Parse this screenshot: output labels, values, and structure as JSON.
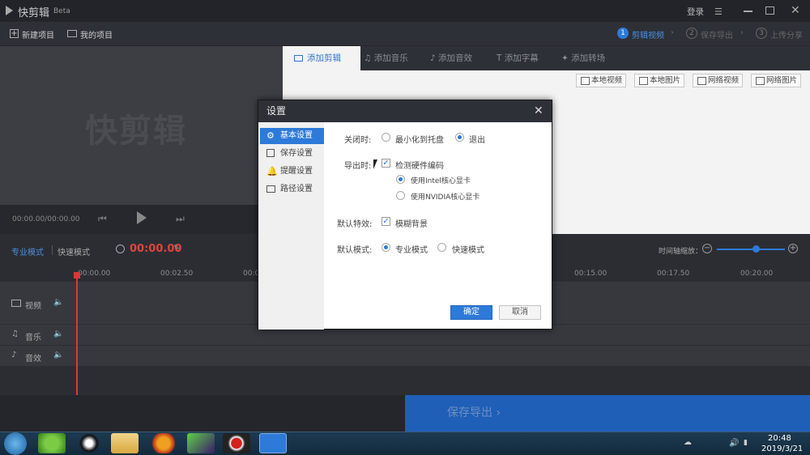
{
  "app": {
    "logo_text": "快剪辑",
    "badge": "Beta",
    "login": "登录",
    "watermark": "快剪辑"
  },
  "toolbar": {
    "new_project": "新建项目",
    "my_projects": "我的项目",
    "steps": [
      {
        "num": "1",
        "label": "剪辑视频"
      },
      {
        "num": "2",
        "label": "保存导出"
      },
      {
        "num": "3",
        "label": "上传分享"
      }
    ]
  },
  "tabs": [
    "添加剪辑",
    "添加音乐",
    "添加音效",
    "添加字幕",
    "添加转场"
  ],
  "sources": [
    "本地视频",
    "本地图片",
    "网络视频",
    "网络图片"
  ],
  "player": {
    "time": "00:00.00/00:00.00"
  },
  "timeline": {
    "mode_pro": "专业模式",
    "mode_fast": "快速模式",
    "time": "00:00.00",
    "zoom_label": "时间轴缩放：",
    "ticks": [
      "00:00.00",
      "00:02.50",
      "00:0",
      "00:15.00",
      "00:17.50",
      "00:20.00"
    ],
    "tracks": [
      "视频",
      "音乐",
      "音效"
    ]
  },
  "footer": {
    "export": "保存导出"
  },
  "taskbar": {
    "time": "20:48",
    "date": "2019/3/21"
  },
  "dialog": {
    "title": "设置",
    "nav": [
      "基本设置",
      "保存设置",
      "提醒设置",
      "路径设置"
    ],
    "close_label": "关闭时:",
    "close_opts": [
      "最小化到托盘",
      "退出"
    ],
    "export_label": "导出时:",
    "export_check": "检测硬件编码",
    "gpu_opts": [
      "使用Intel核心显卡",
      "使用NVIDIA核心显卡"
    ],
    "effect_label": "默认特效:",
    "effect_check": "模糊背景",
    "mode_label": "默认模式:",
    "mode_opts": [
      "专业模式",
      "快速模式"
    ],
    "ok": "确定",
    "cancel": "取消"
  },
  "colors": {
    "accent": "#2e7ad8",
    "timecode": "#e0443a",
    "export_bg": "#1f5fb8"
  }
}
